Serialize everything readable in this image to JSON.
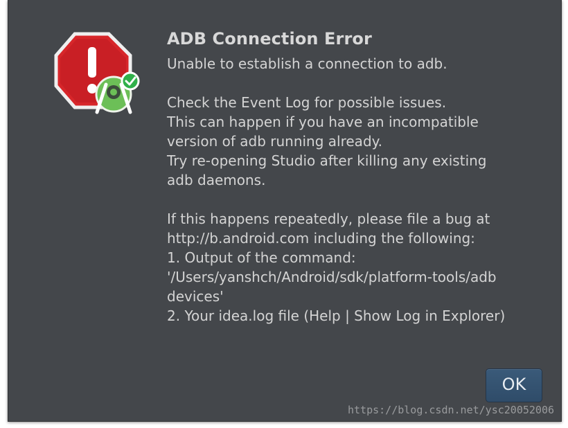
{
  "dialog": {
    "title": "ADB Connection Error",
    "icon": "error-stop-icon",
    "badge_icon": "android-studio-check-icon",
    "message_lines": [
      "Unable to establish a connection to adb.",
      "Check the Event Log for possible issues.",
      "This can happen if you have an incompatible",
      "version of adb running already.",
      "Try re-opening Studio after killing any existing",
      "adb daemons.",
      "If this happens repeatedly, please file a bug at",
      "http://b.android.com including the following:",
      "1. Output of the command:",
      "'/Users/yanshch/Android/sdk/platform-tools/adb",
      " devices'",
      "2. Your idea.log file (Help | Show Log in Explorer)"
    ],
    "ok_label": "OK"
  },
  "watermark": "https://blog.csdn.net/ysc20052006",
  "colors": {
    "dialog_background": "#44474b",
    "text": "#d4d4d4",
    "button_background": "#335170",
    "error_red": "#d7262a",
    "android_green": "#69c05a"
  }
}
